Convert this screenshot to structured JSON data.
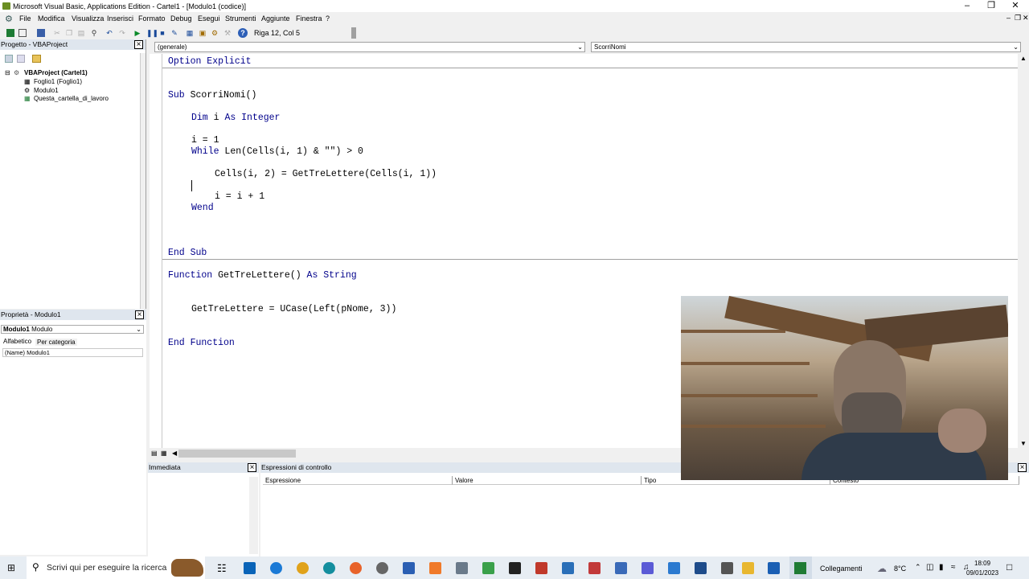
{
  "window": {
    "title": "Microsoft Visual Basic, Applications Edition - Cartel1 - [Modulo1 (codice)]",
    "controls": {
      "minimize": "–",
      "restore": "❐",
      "close": "✕"
    }
  },
  "menu": [
    "File",
    "Modifica",
    "Visualizza",
    "Inserisci",
    "Formato",
    "Debug",
    "Esegui",
    "Strumenti",
    "Aggiunte",
    "Finestra",
    "?"
  ],
  "toolbar": {
    "cursor_position": "Riga 12, Col 5"
  },
  "project_panel": {
    "title": "Progetto - VBAProject",
    "tree": [
      "VBAProject (Cartel1)",
      "Foglio1 (Foglio1)",
      "Modulo1",
      "Questa_cartella_di_lavoro"
    ]
  },
  "properties_panel": {
    "title": "Proprietà - Modulo1",
    "object_name": "Modulo1",
    "object_type": "Modulo",
    "tabs": [
      "Alfabetico",
      "Per categoria"
    ],
    "row_name": "(Name)",
    "row_value": "Modulo1"
  },
  "code_window": {
    "object_combo": "(generale)",
    "proc_combo": "ScorriNomi",
    "lines": [
      {
        "kw": "Option Explicit",
        "text": ""
      },
      {
        "kw": "Sub",
        "text": " ScorriNomi()"
      },
      {
        "kw": "Dim",
        "text": " i ",
        "kw2": "As Integer"
      },
      {
        "kw": "",
        "text": "i = 1"
      },
      {
        "kw": "While",
        "text": " Len(Cells(i, 1) & \"\") > 0"
      },
      {
        "kw": "",
        "text": "Cells(i, 2) = GetTreLettere(Cells(i, 1))"
      },
      {
        "kw": "",
        "text": "i = i + 1"
      },
      {
        "kw": "Wend",
        "text": ""
      },
      {
        "kw": "End Sub",
        "text": ""
      },
      {
        "kw": "Function",
        "text": " GetTreLettere() ",
        "kw2": "As String"
      },
      {
        "kw": "",
        "text": "GetTreLettere = UCase(Left(pNome, 3))"
      },
      {
        "kw": "End Function",
        "text": ""
      }
    ]
  },
  "immediate_panel": {
    "title": "Immediata"
  },
  "watch_panel": {
    "title": "Espressioni di controllo",
    "columns": [
      "Espressione",
      "Valore",
      "Tipo",
      "Contesto"
    ]
  },
  "taskbar": {
    "search_placeholder": "Scrivi qui per eseguire la ricerca",
    "links_label": "Collegamenti",
    "weather": "8°C",
    "time": "18:09",
    "date": "09/01/2023"
  },
  "colors": {
    "keyword": "#00008b",
    "panel_title": "#dfe6ee",
    "taskbar": "#e7edf3"
  }
}
